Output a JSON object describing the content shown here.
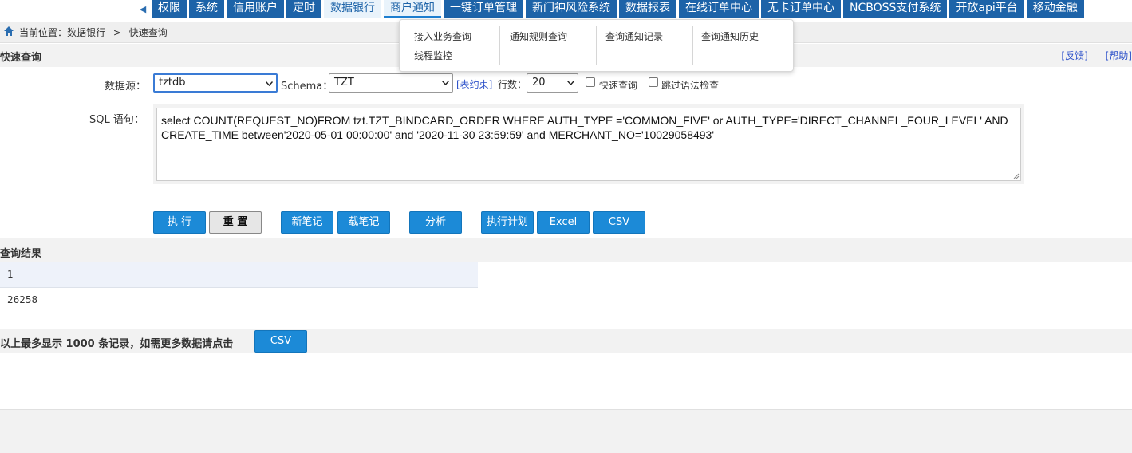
{
  "nav": {
    "tabs": [
      {
        "label": "权限",
        "state": "normal"
      },
      {
        "label": "系统",
        "state": "normal"
      },
      {
        "label": "信用账户",
        "state": "normal"
      },
      {
        "label": "定时",
        "state": "normal"
      },
      {
        "label": "数据银行",
        "state": "light"
      },
      {
        "label": "商户通知",
        "state": "active"
      },
      {
        "label": "一键订单管理",
        "state": "normal"
      },
      {
        "label": "新门神风险系统",
        "state": "normal"
      },
      {
        "label": "数据报表",
        "state": "normal"
      },
      {
        "label": "在线订单中心",
        "state": "normal"
      },
      {
        "label": "无卡订单中心",
        "state": "normal"
      },
      {
        "label": "NCBOSS支付系统",
        "state": "normal"
      },
      {
        "label": "开放api平台",
        "state": "normal"
      },
      {
        "label": "移动金融",
        "state": "normal"
      }
    ]
  },
  "breadcrumb": {
    "prefix": "当前位置：",
    "parent": "数据银行",
    "separator": ">",
    "current": "快速查询"
  },
  "dropdown": {
    "items": [
      "接入业务查询",
      "线程监控",
      "通知规则查询",
      "查询通知记录",
      "查询通知历史"
    ]
  },
  "section": {
    "title": "快速查询",
    "feedback": "[反馈]",
    "help": "[帮助]"
  },
  "form": {
    "datasource_label": "数据源：",
    "datasource_value": "tztdb",
    "schema_label": "Schema：",
    "schema_value": "TZT",
    "table_constraint_link": "[表约束]",
    "rows_label": "行数：",
    "rows_value": "20",
    "quick_query_label": "快速查询",
    "skip_syntax_label": "跳过语法检查",
    "sql_label": "SQL 语句：",
    "sql_text": "select COUNT(REQUEST_NO)FROM tzt.TZT_BINDCARD_ORDER WHERE AUTH_TYPE ='COMMON_FIVE' or AUTH_TYPE='DIRECT_CHANNEL_FOUR_LEVEL'  AND CREATE_TIME between'2020-05-01 00:00:00' and '2020-11-30 23:59:59' and MERCHANT_NO='10029058493'"
  },
  "buttons": {
    "execute": "执 行",
    "reset": "重 置",
    "new_note": "新笔记",
    "load_note": "载笔记",
    "analyze": "分析",
    "exec_plan": "执行计划",
    "excel": "Excel",
    "csv": "CSV"
  },
  "results": {
    "title": "查询结果",
    "header": "1",
    "value": "26258",
    "note": "以上最多显示 1000 条记录，如需更多数据请点击",
    "csv": "CSV"
  },
  "colors": {
    "nav_blue": "#1d63a8",
    "button_blue": "#1c8ad7",
    "link_blue": "#2a4fc9"
  }
}
